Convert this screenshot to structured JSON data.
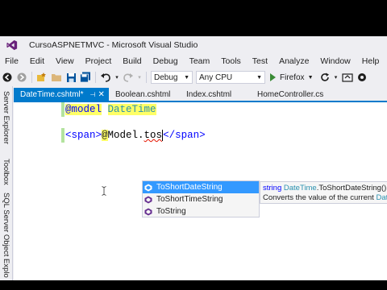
{
  "window": {
    "title": "CursoASPNETMVC - Microsoft Visual Studio"
  },
  "menu": [
    "File",
    "Edit",
    "View",
    "Project",
    "Build",
    "Debug",
    "Team",
    "Tools",
    "Test",
    "Analyze",
    "Window",
    "Help"
  ],
  "toolbar": {
    "config": "Debug",
    "platform": "Any CPU",
    "start_label": "Firefox"
  },
  "side_tabs": [
    "Server Explorer",
    "Toolbox",
    "SQL Server Object Explo"
  ],
  "tabs": [
    {
      "label": "DateTime.cshtml*",
      "active": true
    },
    {
      "label": "Boolean.cshtml",
      "active": false
    },
    {
      "label": "Index.cshtml",
      "active": false
    },
    {
      "label": "HomeController.cs",
      "active": false
    }
  ],
  "code": {
    "line1": {
      "directive": "@model",
      "type": "DateTime"
    },
    "line2": {
      "open_tag": "<span>",
      "at": "@",
      "expr": "Model.",
      "typed": "tos",
      "close_tag": "</span>"
    }
  },
  "intellisense": {
    "items": [
      "ToShortDateString",
      "ToShortTimeString",
      "ToString"
    ],
    "selected_index": 0
  },
  "tooltip": {
    "return_type": "string",
    "type_name": "DateTime",
    "signature": ".ToShortDateString()",
    "description": "Converts the value of the current ",
    "description_tail": "Date"
  },
  "colors": {
    "accent": "#007acc",
    "selection": "#3399ff",
    "razor_highlight": "#ffff66",
    "vs_purple": "#68217a",
    "change_bar": "#b3e39e"
  }
}
